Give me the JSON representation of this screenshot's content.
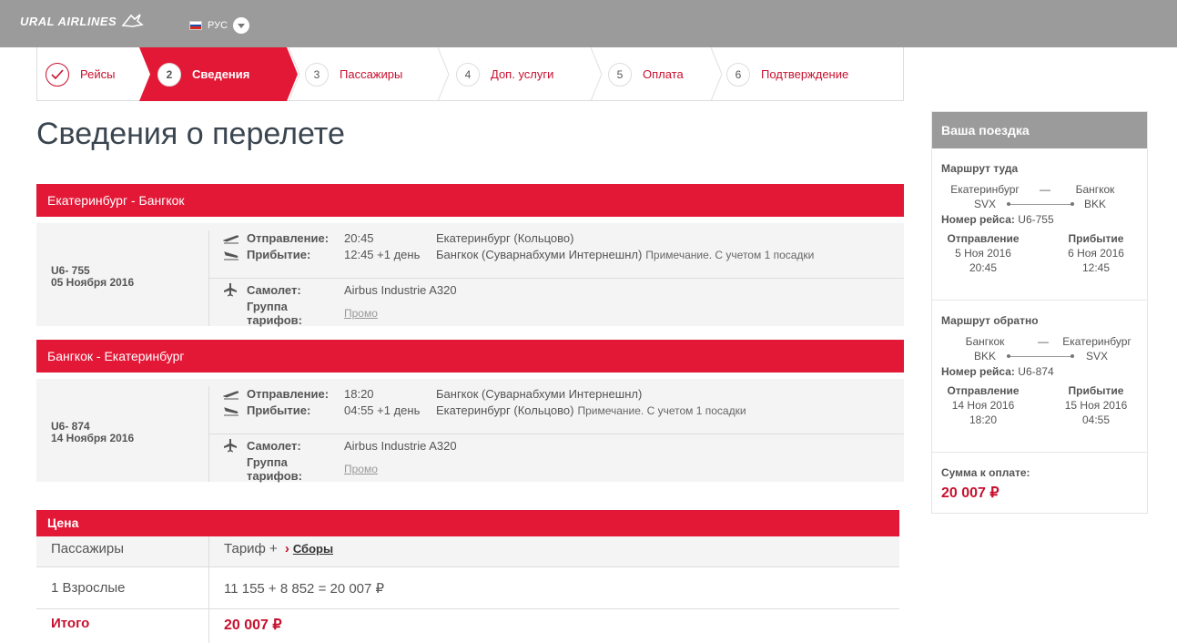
{
  "header": {
    "logo_text": "URAL AIRLINES",
    "language": "РУС"
  },
  "steps": [
    {
      "num": "",
      "label": "Рейсы",
      "state": "done"
    },
    {
      "num": "2",
      "label": "Сведения",
      "state": "active"
    },
    {
      "num": "3",
      "label": "Пассажиры",
      "state": "todo"
    },
    {
      "num": "4",
      "label": "Доп. услуги",
      "state": "todo"
    },
    {
      "num": "5",
      "label": "Оплата",
      "state": "todo"
    },
    {
      "num": "6",
      "label": "Подтверждение",
      "state": "todo"
    }
  ],
  "page_title": "Сведения о перелете",
  "flights": [
    {
      "route": "Екатеринбург - Бангкок",
      "flight_no": "U6- 755",
      "date": "05 Ноября 2016",
      "departure_label": "Отправление:",
      "departure_time": "20:45",
      "departure_place": "Екатеринбург (Кольцово)",
      "arrival_label": "Прибытие:",
      "arrival_time": "12:45 +1 день",
      "arrival_place": "Бангкок (Суварнабхуми Интернешнл)",
      "note": "Примечание. С учетом 1 посадки",
      "aircraft_label": "Самолет:",
      "aircraft": "Airbus Industrie A320",
      "fare_label": "Группа тарифов:",
      "fare": "Промо"
    },
    {
      "route": "Бангкок - Екатеринбург",
      "flight_no": "U6- 874",
      "date": "14 Ноября 2016",
      "departure_label": "Отправление:",
      "departure_time": "18:20",
      "departure_place": "Бангкок (Суварнабхуми Интернешнл)",
      "arrival_label": "Прибытие:",
      "arrival_time": "04:55 +1 день",
      "arrival_place": "Екатеринбург (Кольцово)",
      "note": "Примечание. С учетом 1 посадки",
      "aircraft_label": "Самолет:",
      "aircraft": "Airbus Industrie A320",
      "fare_label": "Группа тарифов:",
      "fare": "Промо"
    }
  ],
  "price": {
    "title": "Цена",
    "col_passengers": "Пассажиры",
    "col_tariff": "Тариф +",
    "fees_link": "Сборы",
    "passenger_row": "1 Взрослые",
    "calculation": "11 155 + 8 852 = 20 007 ₽",
    "total_label": "Итого",
    "total_value": "20 007 ₽"
  },
  "sidebar": {
    "title": "Ваша поездка",
    "outbound": {
      "title": "Маршрут туда",
      "from_city": "Екатеринбург",
      "from_code": "SVX",
      "dash": "—",
      "to_city": "Бангкок",
      "to_code": "BKK",
      "flight_label": "Номер рейса:",
      "flight_no": "U6-755",
      "dep_label": "Отправление",
      "dep_date": "5 Ноя 2016",
      "dep_time": "20:45",
      "arr_label": "Прибытие",
      "arr_date": "6 Ноя 2016",
      "arr_time": "12:45"
    },
    "return": {
      "title": "Маршрут обратно",
      "from_city": "Бангкок",
      "from_code": "BKK",
      "dash": "—",
      "to_city": "Екатеринбург",
      "to_code": "SVX",
      "flight_label": "Номер рейса:",
      "flight_no": "U6-874",
      "dep_label": "Отправление",
      "dep_date": "14 Ноя 2016",
      "dep_time": "18:20",
      "arr_label": "Прибытие",
      "arr_date": "15 Ноя 2016",
      "arr_time": "04:55"
    },
    "sum_label": "Сумма к оплате:",
    "sum_value": "20 007 ₽"
  },
  "colors": {
    "brand_red": "#e31837",
    "header_gray": "#9b9b9b"
  }
}
